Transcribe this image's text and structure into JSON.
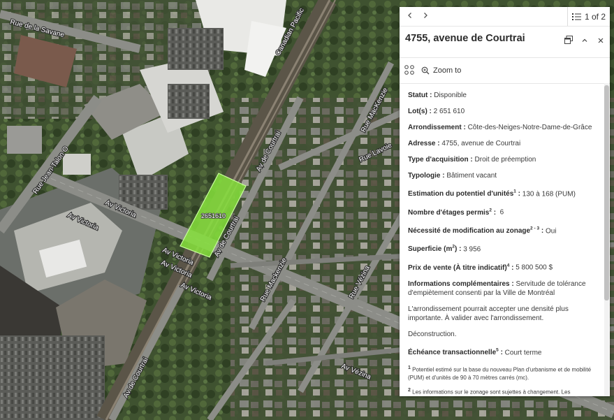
{
  "map": {
    "road_labels": {
      "savane": "Rue de la Savane",
      "jean_talon": "Rue Jean-Talon O",
      "victoria_1": "Av Victoria",
      "victoria_2": "Av Victoria",
      "victoria_3": "Av Victoria",
      "victoria_4": "Av Victoria",
      "victoria_5": "Av Victoria",
      "courtrai_1": "Av de Courtrai",
      "courtrai_2": "Av de Courtrai",
      "courtrai_3": "Av de Courtrai",
      "mackenzie_1": "Rue MacKenzie",
      "mackenzie_2": "Rue Mackenzie",
      "lavoie": "Rue Lavoie",
      "vezina_1": "Rue Vézina",
      "vezina_2": "Av Vézina",
      "canadian_pacific": "Canadian Pacific"
    },
    "lot_label": "2651610",
    "lot_color": "#86e23c"
  },
  "popup": {
    "pager_text": "1 of 2",
    "title": "4755, avenue de Courtrai",
    "zoom_label": "Zoom to",
    "fields": [
      {
        "label": "Statut :",
        "value": " Disponible"
      },
      {
        "label": "Lot(s) :",
        "value": " 2 651 610"
      },
      {
        "label": "Arrondissement :",
        "value": " Côte-des-Neiges-Notre-Dame-de-Grâce"
      },
      {
        "label": "Adresse :",
        "value": " 4755, avenue de Courtrai"
      },
      {
        "label": "Type d'acquisition :",
        "value": " Droit de préemption"
      },
      {
        "label": "Typologie :",
        "value": " Bâtiment vacant"
      }
    ],
    "potentiel": {
      "label": "Estimation du potentiel d'unités",
      "sup": "1",
      "colon": " :",
      "value": " 130 à 168 (PUM)"
    },
    "etages": {
      "label": "Nombre d'étages permis",
      "sup": "2",
      "colon": " :",
      "value": "  6"
    },
    "zonage": {
      "label": "Nécessité de modification au zonage",
      "sup": "2 - 3",
      "colon": " :",
      "value": " Oui"
    },
    "superficie": {
      "label": "Superficie (m",
      "sup": "2",
      "label_end": ") :",
      "value": " 3 956"
    },
    "prix": {
      "label": "Prix de vente (À titre indicatif)",
      "sup": "4",
      "colon": " :",
      "value": " 5 800 500 $"
    },
    "infos": {
      "label": "Informations complémentaires :",
      "value": " Servitude de tolérance d'empiètement consenti par la Ville de Montréal"
    },
    "para_densite": "L'arrondissement pourrait accepter une densité plus importante. À valider avec l'arrondissement.",
    "para_deconstruction": "Déconstruction.",
    "echeance": {
      "label": "Échéance transactionnelle",
      "sup": "5",
      "colon": " :",
      "value": " Court terme"
    },
    "note1": {
      "num": "1",
      "text": " Potentiel estimé sur la base du nouveau Plan d'urbanisme et de mobilité (PUM) et d'unités de 90 à 70 mètres carrés (mc)."
    },
    "note2": {
      "num": "2",
      "text": " Les informations sur le zonage sont sujettes à changement. Les demandeurs sont invités à consulter les arrondissements pour confirmer la faisabilité des projets."
    }
  }
}
